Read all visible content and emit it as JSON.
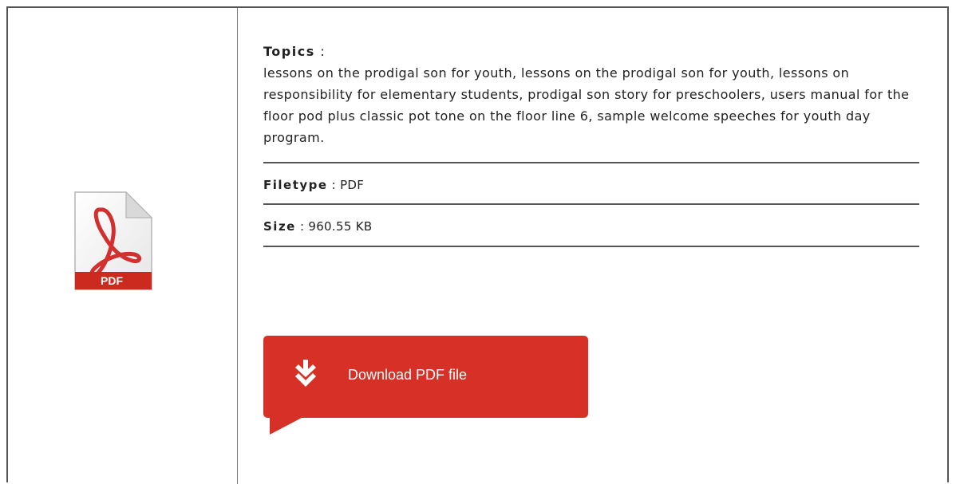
{
  "topics": {
    "label": "Topics",
    "separator": ":",
    "text": "lessons on the prodigal son for youth, lessons on the prodigal son for youth, lessons on responsibility for elementary students, prodigal son story for preschoolers, users manual for the floor pod plus classic pot tone on the floor line 6, sample welcome speeches for youth day program."
  },
  "filetype": {
    "label": "Filetype",
    "separator": ":",
    "value": "PDF"
  },
  "size": {
    "label": "Size",
    "separator": ":",
    "value": "960.55 KB"
  },
  "file_icon": {
    "label": "PDF",
    "icon": "pdf-file-icon",
    "accent": "#d32f2f"
  },
  "download_button": {
    "label": "Download PDF file",
    "icon": "download-arrow-icon",
    "color": "#d63027"
  }
}
